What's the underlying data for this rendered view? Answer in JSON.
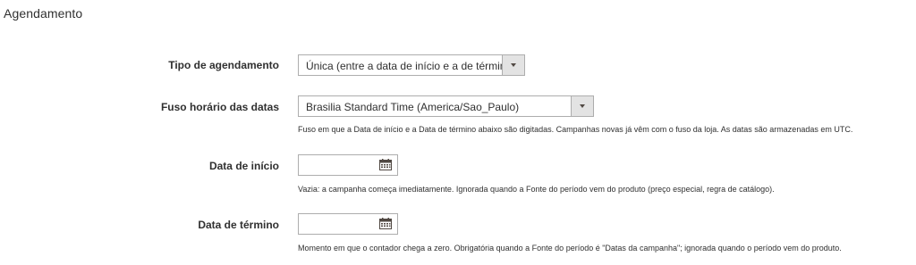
{
  "section": {
    "title": "Agendamento"
  },
  "fields": {
    "schedule_type": {
      "label": "Tipo de agendamento",
      "value": "Única (entre a data de início e a de término)"
    },
    "timezone": {
      "label": "Fuso horário das datas",
      "value": "Brasilia Standard Time (America/Sao_Paulo)",
      "note": "Fuso em que a Data de início e a Data de término abaixo são digitadas. Campanhas novas já vêm com o fuso da loja. As datas são armazenadas em UTC."
    },
    "start_date": {
      "label": "Data de início",
      "value": "",
      "note": "Vazia: a campanha começa imediatamente. Ignorada quando a Fonte do período vem do produto (preço especial, regra de catálogo)."
    },
    "end_date": {
      "label": "Data de término",
      "value": "",
      "note": "Momento em que o contador chega a zero. Obrigatória quando a Fonte do período é \"Datas da campanha\"; ignorada quando o período vem do produto."
    }
  },
  "icons": {
    "calendar": "calendar-icon",
    "dropdown": "chevron-down-icon"
  },
  "colors": {
    "border": "#adadad",
    "arrow_bg": "#e3e3e3",
    "text": "#303030"
  }
}
